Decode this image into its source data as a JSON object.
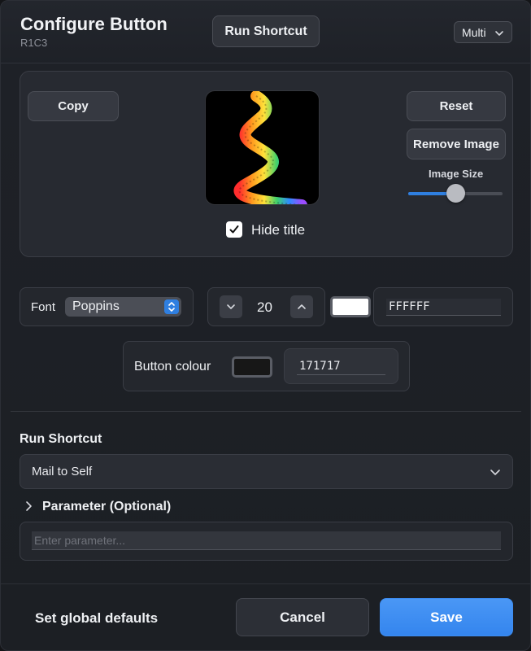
{
  "header": {
    "title": "Configure Button",
    "subtitle": "R1C3",
    "run_shortcut_button": "Run Shortcut",
    "mode_select": "Multi"
  },
  "image_panel": {
    "copy_label": "Copy",
    "reset_label": "Reset",
    "remove_image_label": "Remove Image",
    "image_size_label": "Image Size",
    "image_size_value": 0.5,
    "hide_title_label": "Hide title",
    "hide_title_checked": true
  },
  "font_row": {
    "font_label": "Font",
    "font_value": "Poppins",
    "size_value": "20",
    "text_color_hex": "FFFFFF",
    "text_color": "#ffffff"
  },
  "button_colour": {
    "label": "Button colour",
    "hex": "171717",
    "color": "#171717"
  },
  "run_shortcut": {
    "section_label": "Run Shortcut",
    "selected_shortcut": "Mail to Self",
    "parameter_label": "Parameter (Optional)",
    "parameter_placeholder": "Enter parameter..."
  },
  "footer": {
    "global_defaults_label": "Set global defaults",
    "cancel_label": "Cancel",
    "save_label": "Save"
  },
  "colors": {
    "accent": "#2f7fe0",
    "save_button": "#3d8df2"
  }
}
